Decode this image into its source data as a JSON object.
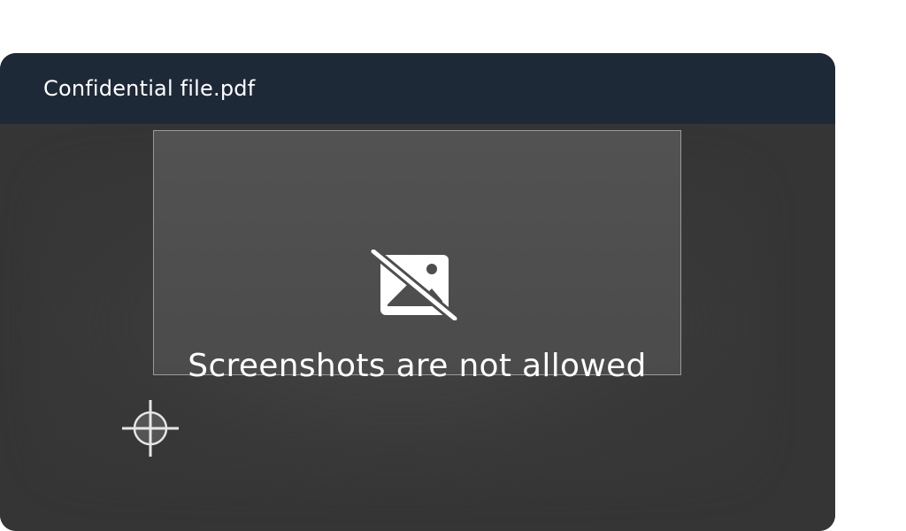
{
  "window": {
    "title": "Confidential file.pdf"
  },
  "overlay": {
    "message": "Screenshots are not allowed",
    "icon": "image-off-icon"
  },
  "cursor": {
    "icon": "crosshair-cursor-icon"
  },
  "colors": {
    "titlebar": "#1e2938",
    "content_background": "#353535",
    "selection_fill": "#4f4f4f",
    "selection_border": "#9a9a9a",
    "text": "#ffffff"
  }
}
